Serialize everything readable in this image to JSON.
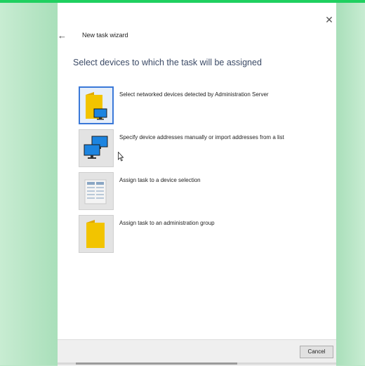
{
  "window": {
    "title": "New task wizard",
    "close_icon": "close-icon",
    "back_icon": "back-arrow-icon"
  },
  "page": {
    "heading": "Select devices to which the task will be assigned"
  },
  "options": [
    {
      "label": "Select networked devices detected by Administration Server",
      "icon": "folder-monitor-icon",
      "selected": true
    },
    {
      "label": "Specify device addresses manually or import addresses from a list",
      "icon": "monitors-icon",
      "selected": false
    },
    {
      "label": "Assign task to a device selection",
      "icon": "device-selection-icon",
      "selected": false
    },
    {
      "label": "Assign task to an administration group",
      "icon": "folder-icon",
      "selected": false
    }
  ],
  "footer": {
    "cancel_label": "Cancel"
  },
  "colors": {
    "accent": "#3a78d8",
    "background": "#b9e6c6",
    "top_strip": "#1fd060",
    "folder": "#f2c400"
  }
}
